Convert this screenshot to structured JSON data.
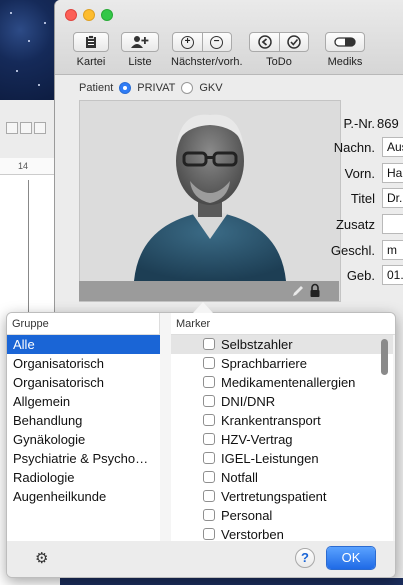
{
  "toolbar": {
    "items": [
      {
        "label": "Kartei",
        "icon": "clipboard-icon"
      },
      {
        "label": "Liste",
        "icon": "add-person-icon"
      },
      {
        "label": "Nächster/vorh.",
        "icon": "plus-minus-icon"
      },
      {
        "label": "ToDo",
        "icon": "back-check-icon"
      },
      {
        "label": "Mediks",
        "icon": "pill-icon"
      }
    ],
    "nav_plus": "+",
    "nav_minus": "−"
  },
  "background_window": {
    "ruler_mark": "14"
  },
  "patient_type": {
    "label": "Patient",
    "options": [
      "PRIVAT",
      "GKV"
    ],
    "selected": "PRIVAT"
  },
  "patient_fields": [
    {
      "label": "P.-Nr.",
      "value": "869"
    },
    {
      "label": "Nachn.",
      "value": "Aus"
    },
    {
      "label": "Vorn.",
      "value": "Ha"
    },
    {
      "label": "Titel",
      "value": "Dr."
    },
    {
      "label": "Zusatz",
      "value": ""
    },
    {
      "label": "Geschl.",
      "value": "m"
    },
    {
      "label": "Geb.",
      "value": "01."
    }
  ],
  "popover": {
    "groups_header": "Gruppe",
    "markers_header": "Marker",
    "groups": [
      "Alle",
      "Organisatorisch",
      "Organisatorisch",
      "Allgemein",
      "Behandlung",
      "Gynäkologie",
      "Psychiatrie & Psycho…",
      "Radiologie",
      "Augenheilkunde"
    ],
    "selected_group": "Alle",
    "markers": [
      "Selbstzahler",
      "Sprachbarriere",
      "Medikamentenallergien",
      "DNI/DNR",
      "Krankentransport",
      "HZV-Vertrag",
      "IGEL-Leistungen",
      "Notfall",
      "Vertretungspatient",
      "Personal",
      "Verstorben"
    ],
    "help_label": "?",
    "ok_label": "OK",
    "gear_icon": "gear-icon"
  },
  "colors": {
    "accent": "#1a65d6",
    "ok_button": "#2f7cf6",
    "close": "#fc5f57",
    "minimize": "#fdbc2e",
    "zoom": "#33c748"
  }
}
